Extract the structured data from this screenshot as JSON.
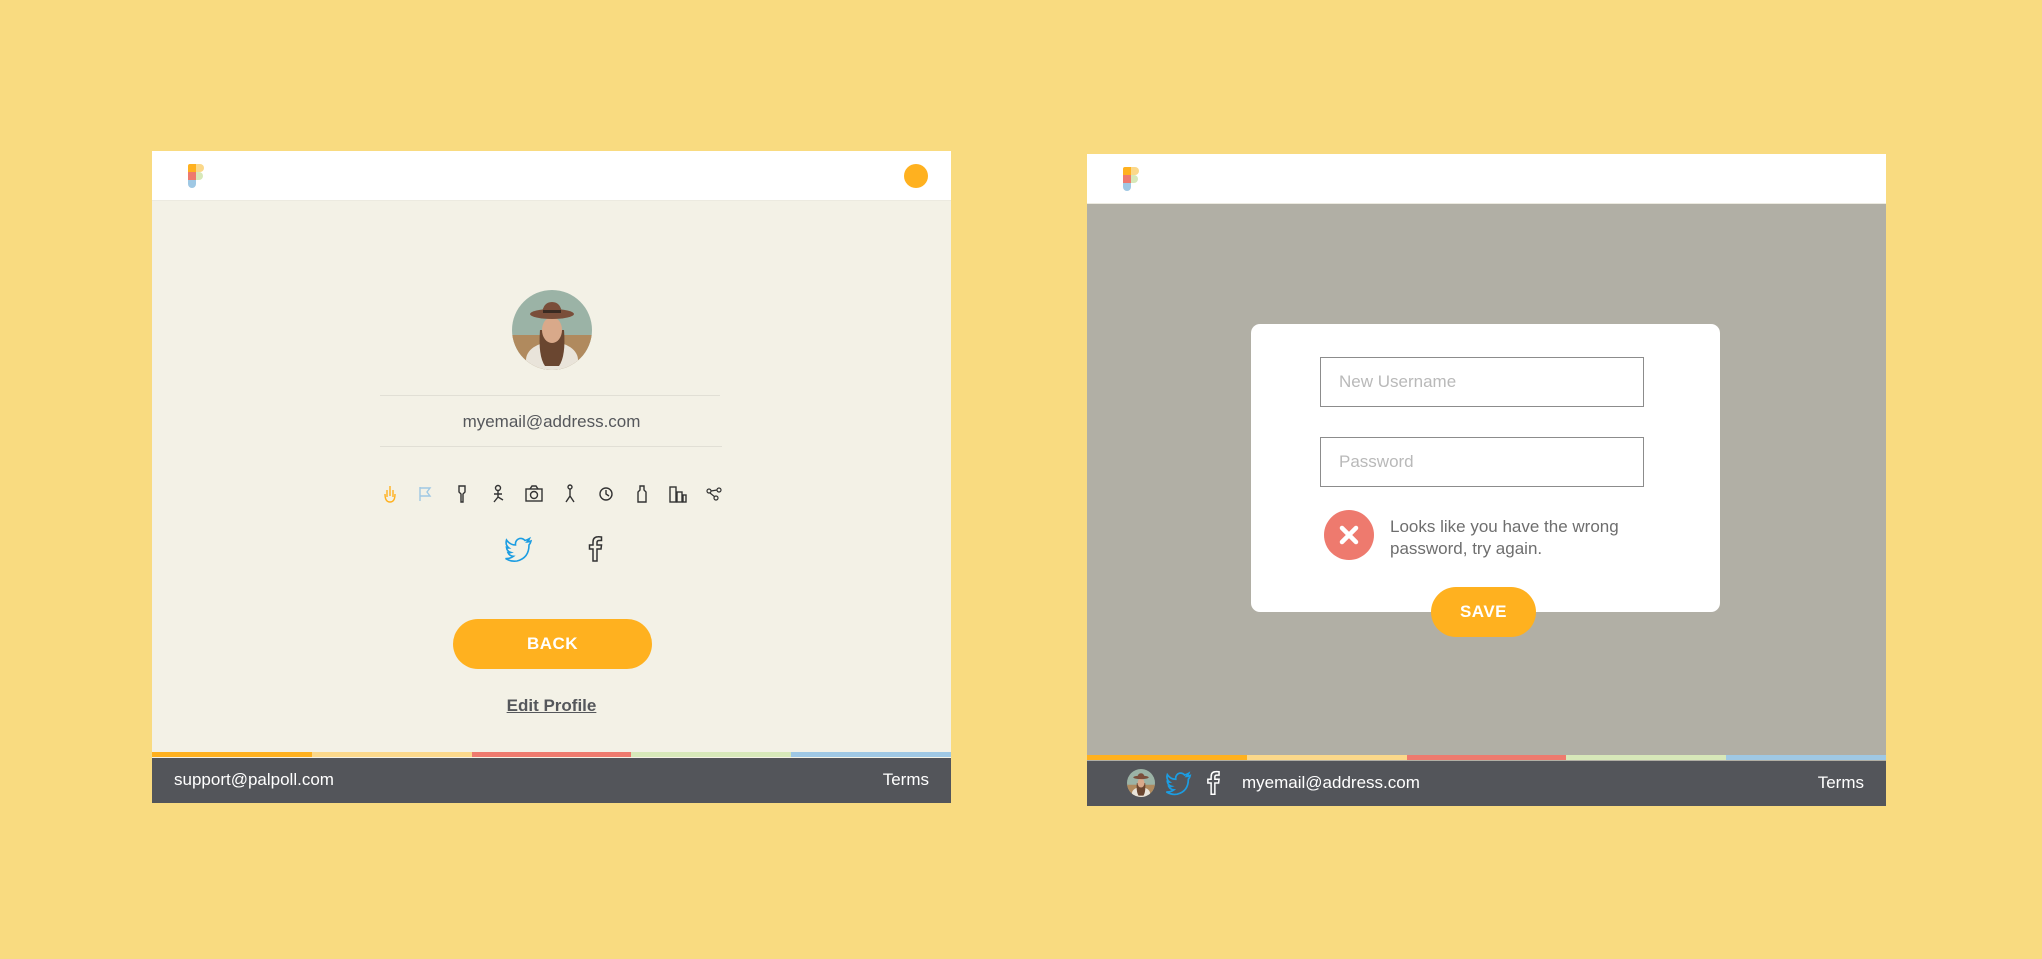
{
  "colors": {
    "background": "#F9DB80",
    "accent": "#FFB11F",
    "footer": "#53555A",
    "error": "#EE7A6E",
    "overlay": "#B1AFA5"
  },
  "left_screen": {
    "logo_icon": "palpoll-logo",
    "header_dot_icon": "orange-dot",
    "avatar_icon": "profile-photo",
    "email": "myemail@address.com",
    "icon_row": [
      "hand-icon",
      "flag-icon",
      "torch-icon",
      "person-icon",
      "camera-icon",
      "figure-icon",
      "clock-icon",
      "bottle-icon",
      "buildings-icon",
      "share-icon"
    ],
    "social": [
      "twitter-icon",
      "facebook-icon"
    ],
    "back_button": "BACK",
    "edit_link": "Edit Profile",
    "footer": {
      "left": "support@palpoll.com",
      "right": "Terms"
    }
  },
  "right_screen": {
    "logo_icon": "palpoll-logo",
    "username_placeholder": "New Username",
    "password_placeholder": "Password",
    "error_icon": "close-icon",
    "error_message": "Looks like you have the wrong password, try again.",
    "save_button": "SAVE",
    "footer": {
      "email": "myemail@address.com",
      "right": "Terms",
      "icons": [
        "profile-photo",
        "twitter-icon",
        "facebook-icon"
      ]
    }
  }
}
